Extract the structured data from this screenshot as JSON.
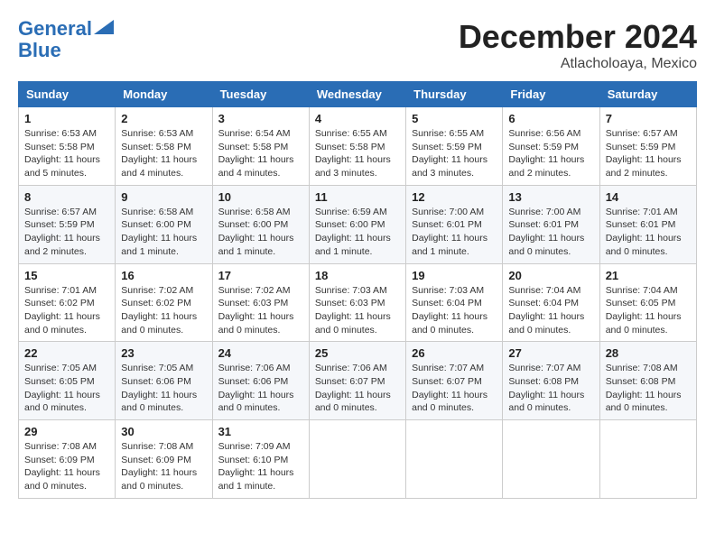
{
  "header": {
    "logo_line1": "General",
    "logo_line2": "Blue",
    "month": "December 2024",
    "location": "Atlacholoaya, Mexico"
  },
  "weekdays": [
    "Sunday",
    "Monday",
    "Tuesday",
    "Wednesday",
    "Thursday",
    "Friday",
    "Saturday"
  ],
  "weeks": [
    [
      {
        "day": "1",
        "sunrise": "6:53 AM",
        "sunset": "5:58 PM",
        "daylight": "11 hours and 5 minutes."
      },
      {
        "day": "2",
        "sunrise": "6:53 AM",
        "sunset": "5:58 PM",
        "daylight": "11 hours and 4 minutes."
      },
      {
        "day": "3",
        "sunrise": "6:54 AM",
        "sunset": "5:58 PM",
        "daylight": "11 hours and 4 minutes."
      },
      {
        "day": "4",
        "sunrise": "6:55 AM",
        "sunset": "5:58 PM",
        "daylight": "11 hours and 3 minutes."
      },
      {
        "day": "5",
        "sunrise": "6:55 AM",
        "sunset": "5:59 PM",
        "daylight": "11 hours and 3 minutes."
      },
      {
        "day": "6",
        "sunrise": "6:56 AM",
        "sunset": "5:59 PM",
        "daylight": "11 hours and 2 minutes."
      },
      {
        "day": "7",
        "sunrise": "6:57 AM",
        "sunset": "5:59 PM",
        "daylight": "11 hours and 2 minutes."
      }
    ],
    [
      {
        "day": "8",
        "sunrise": "6:57 AM",
        "sunset": "5:59 PM",
        "daylight": "11 hours and 2 minutes."
      },
      {
        "day": "9",
        "sunrise": "6:58 AM",
        "sunset": "6:00 PM",
        "daylight": "11 hours and 1 minute."
      },
      {
        "day": "10",
        "sunrise": "6:58 AM",
        "sunset": "6:00 PM",
        "daylight": "11 hours and 1 minute."
      },
      {
        "day": "11",
        "sunrise": "6:59 AM",
        "sunset": "6:00 PM",
        "daylight": "11 hours and 1 minute."
      },
      {
        "day": "12",
        "sunrise": "7:00 AM",
        "sunset": "6:01 PM",
        "daylight": "11 hours and 1 minute."
      },
      {
        "day": "13",
        "sunrise": "7:00 AM",
        "sunset": "6:01 PM",
        "daylight": "11 hours and 0 minutes."
      },
      {
        "day": "14",
        "sunrise": "7:01 AM",
        "sunset": "6:01 PM",
        "daylight": "11 hours and 0 minutes."
      }
    ],
    [
      {
        "day": "15",
        "sunrise": "7:01 AM",
        "sunset": "6:02 PM",
        "daylight": "11 hours and 0 minutes."
      },
      {
        "day": "16",
        "sunrise": "7:02 AM",
        "sunset": "6:02 PM",
        "daylight": "11 hours and 0 minutes."
      },
      {
        "day": "17",
        "sunrise": "7:02 AM",
        "sunset": "6:03 PM",
        "daylight": "11 hours and 0 minutes."
      },
      {
        "day": "18",
        "sunrise": "7:03 AM",
        "sunset": "6:03 PM",
        "daylight": "11 hours and 0 minutes."
      },
      {
        "day": "19",
        "sunrise": "7:03 AM",
        "sunset": "6:04 PM",
        "daylight": "11 hours and 0 minutes."
      },
      {
        "day": "20",
        "sunrise": "7:04 AM",
        "sunset": "6:04 PM",
        "daylight": "11 hours and 0 minutes."
      },
      {
        "day": "21",
        "sunrise": "7:04 AM",
        "sunset": "6:05 PM",
        "daylight": "11 hours and 0 minutes."
      }
    ],
    [
      {
        "day": "22",
        "sunrise": "7:05 AM",
        "sunset": "6:05 PM",
        "daylight": "11 hours and 0 minutes."
      },
      {
        "day": "23",
        "sunrise": "7:05 AM",
        "sunset": "6:06 PM",
        "daylight": "11 hours and 0 minutes."
      },
      {
        "day": "24",
        "sunrise": "7:06 AM",
        "sunset": "6:06 PM",
        "daylight": "11 hours and 0 minutes."
      },
      {
        "day": "25",
        "sunrise": "7:06 AM",
        "sunset": "6:07 PM",
        "daylight": "11 hours and 0 minutes."
      },
      {
        "day": "26",
        "sunrise": "7:07 AM",
        "sunset": "6:07 PM",
        "daylight": "11 hours and 0 minutes."
      },
      {
        "day": "27",
        "sunrise": "7:07 AM",
        "sunset": "6:08 PM",
        "daylight": "11 hours and 0 minutes."
      },
      {
        "day": "28",
        "sunrise": "7:08 AM",
        "sunset": "6:08 PM",
        "daylight": "11 hours and 0 minutes."
      }
    ],
    [
      {
        "day": "29",
        "sunrise": "7:08 AM",
        "sunset": "6:09 PM",
        "daylight": "11 hours and 0 minutes."
      },
      {
        "day": "30",
        "sunrise": "7:08 AM",
        "sunset": "6:09 PM",
        "daylight": "11 hours and 0 minutes."
      },
      {
        "day": "31",
        "sunrise": "7:09 AM",
        "sunset": "6:10 PM",
        "daylight": "11 hours and 1 minute."
      },
      null,
      null,
      null,
      null
    ]
  ]
}
